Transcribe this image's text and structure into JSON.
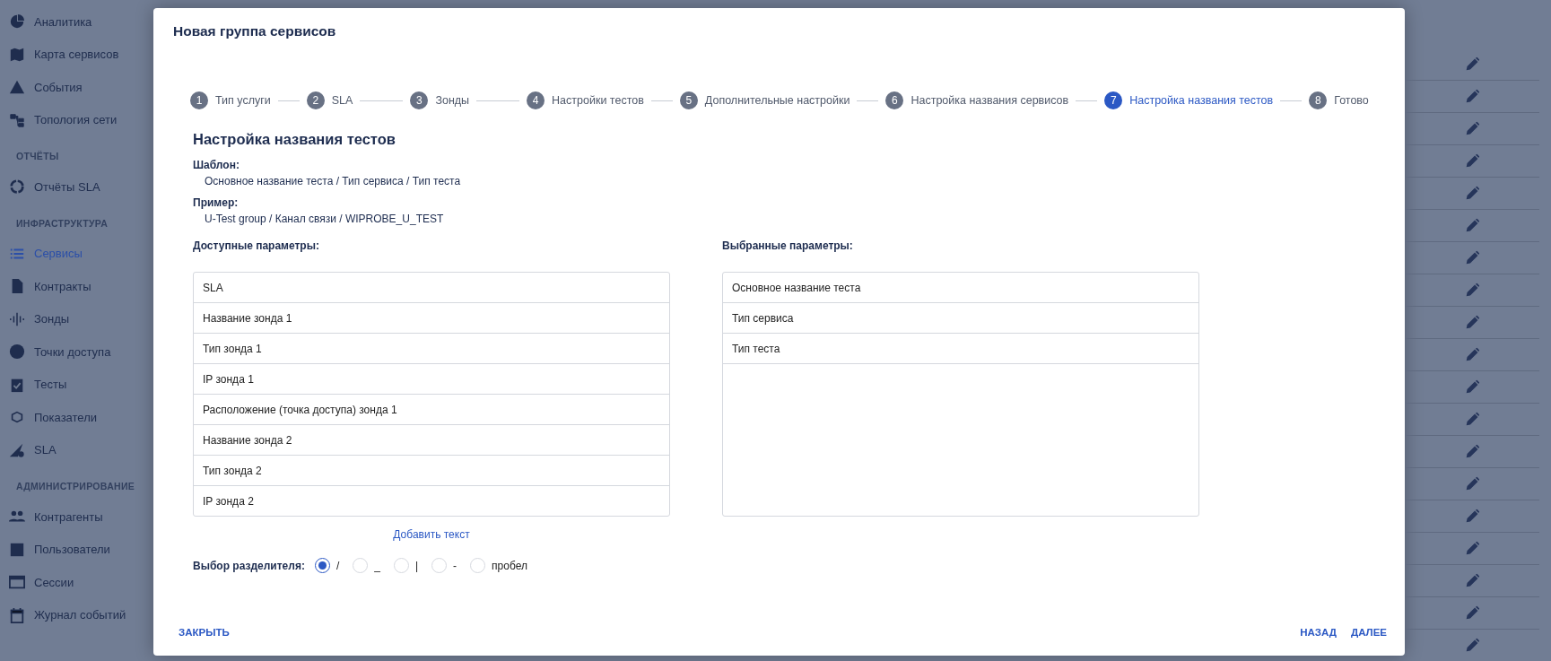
{
  "sidebar": {
    "sections": [
      {
        "items": [
          {
            "label": "Аналитика",
            "selected": false
          },
          {
            "label": "Карта сервисов",
            "selected": false
          },
          {
            "label": "События",
            "selected": false
          },
          {
            "label": "Топология сети",
            "selected": false
          }
        ]
      },
      {
        "heading": "ОТЧЁТЫ",
        "items": [
          {
            "label": "Отчёты SLA",
            "selected": false
          }
        ]
      },
      {
        "heading": "ИНФРАСТРУКТУРА",
        "items": [
          {
            "label": "Сервисы",
            "selected": true
          },
          {
            "label": "Контракты",
            "selected": false
          },
          {
            "label": "Зонды",
            "selected": false
          },
          {
            "label": "Точки доступа",
            "selected": false
          },
          {
            "label": "Тесты",
            "selected": false
          },
          {
            "label": "Показатели",
            "selected": false
          },
          {
            "label": "SLA",
            "selected": false
          }
        ]
      },
      {
        "heading": "АДМИНИСТРИРОВАНИЕ",
        "items": [
          {
            "label": "Контрагенты",
            "selected": false
          },
          {
            "label": "Пользователи",
            "selected": false
          },
          {
            "label": "Сессии",
            "selected": false
          },
          {
            "label": "Журнал событий",
            "selected": false
          }
        ]
      }
    ]
  },
  "dialog": {
    "title": "Новая группа сервисов",
    "steps": [
      {
        "number": "1",
        "label": "Тип услуги",
        "selected": false
      },
      {
        "number": "2",
        "label": "SLA",
        "selected": false
      },
      {
        "number": "3",
        "label": "Зонды",
        "selected": false
      },
      {
        "number": "4",
        "label": "Настройки тестов",
        "selected": false
      },
      {
        "number": "5",
        "label": "Дополнительные настройки",
        "selected": false
      },
      {
        "number": "6",
        "label": "Настройка названия сервисов",
        "selected": false
      },
      {
        "number": "7",
        "label": "Настройка названия тестов",
        "selected": true
      },
      {
        "number": "8",
        "label": "Готово",
        "selected": false
      }
    ],
    "heading": "Настройка названия тестов",
    "template": {
      "label": "Шаблон:",
      "value": "Основное название теста / Тип сервиса / Тип теста"
    },
    "example": {
      "label": "Пример:",
      "value": "U-Test group / Канал связи / WIPROBE_U_TEST"
    },
    "available": {
      "label": "Доступные параметры:",
      "items": [
        "SLA",
        "Название зонда 1",
        "Тип зонда 1",
        "IP зонда 1",
        "Расположение (точка доступа) зонда 1",
        "Название зонда 2",
        "Тип зонда 2",
        "IP зонда 2"
      ]
    },
    "chosen": {
      "label": "Выбранные параметры:",
      "items": [
        "Основное название теста",
        "Тип сервиса",
        "Тип теста"
      ]
    },
    "add_text": "Добавить текст",
    "separator": {
      "label": "Выбор разделителя:",
      "options": [
        {
          "label": "/",
          "selected": true
        },
        {
          "label": "_",
          "selected": false
        },
        {
          "label": "|",
          "selected": false
        },
        {
          "label": "-",
          "selected": false
        },
        {
          "label": "пробел",
          "selected": false
        }
      ]
    },
    "buttons": {
      "close": "ЗАКРЫТЬ",
      "back": "НАЗАД",
      "next": "ДАЛЕЕ"
    }
  }
}
